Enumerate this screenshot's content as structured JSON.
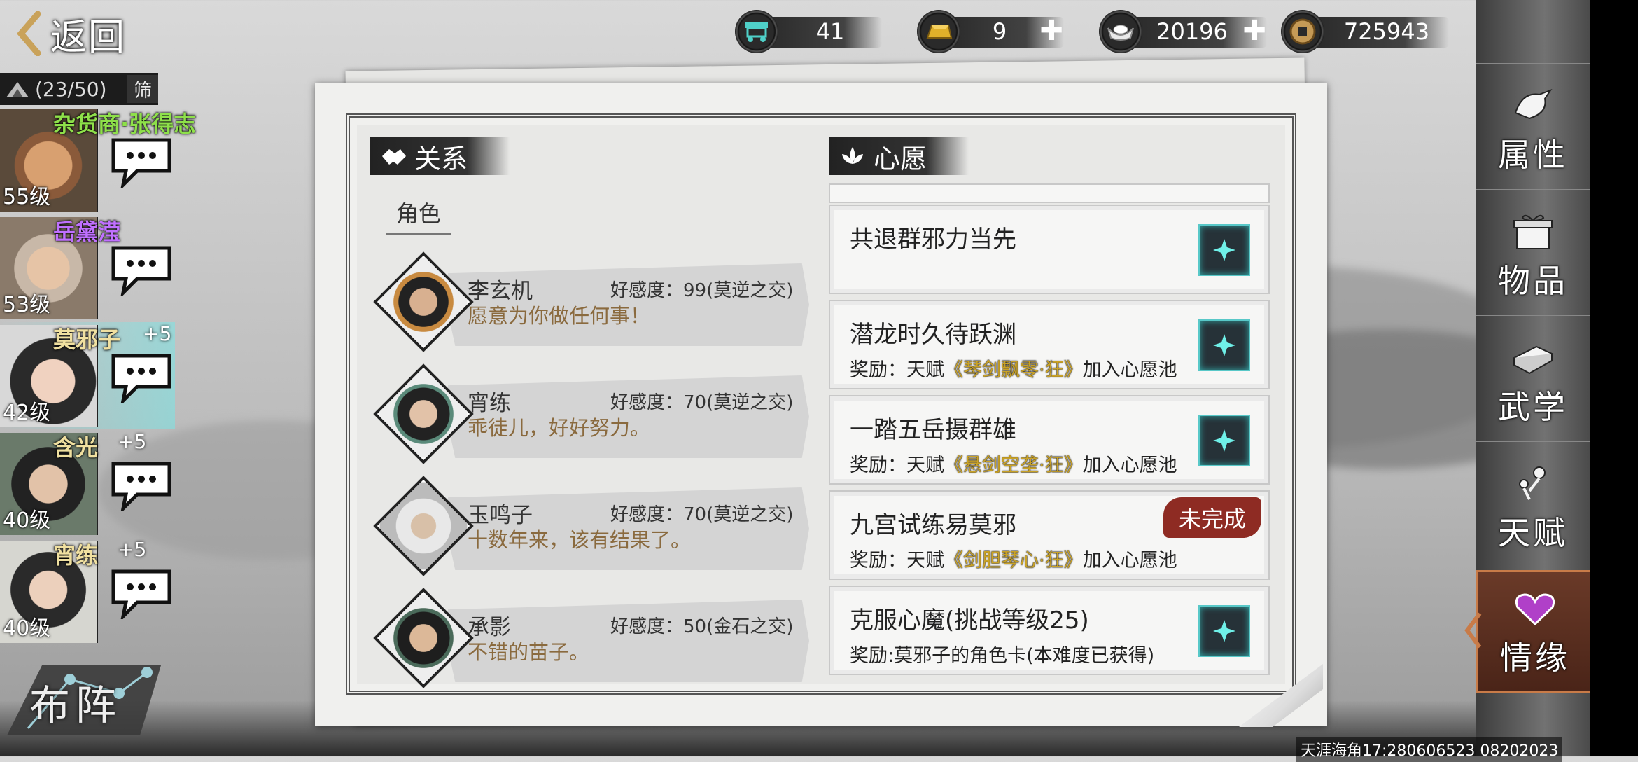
{
  "header": {
    "back_label": "返回",
    "currencies": [
      {
        "icon": "cart-icon",
        "value": "41",
        "has_plus": false
      },
      {
        "icon": "gold-ingot-icon",
        "value": "9",
        "has_plus": true
      },
      {
        "icon": "silver-ingot-icon",
        "value": "20196",
        "has_plus": true
      },
      {
        "icon": "copper-coin-icon",
        "value": "725943",
        "has_plus": false
      }
    ]
  },
  "roster": {
    "count": "(23/50)",
    "filter_label": "筛",
    "members": [
      {
        "name": "杂货商·张得志",
        "level": "55级",
        "bonus": "",
        "name_color": "#8ee04a",
        "active": false
      },
      {
        "name": "岳黛滢",
        "level": "53级",
        "bonus": "",
        "name_color": "#c070ff",
        "active": false
      },
      {
        "name": "莫邪子",
        "level": "42级",
        "bonus": "+5",
        "name_color": "#f0e0a0",
        "active": true
      },
      {
        "name": "含光",
        "level": "40级",
        "bonus": "+5",
        "name_color": "#f0e0a0",
        "active": false
      },
      {
        "name": "宵练",
        "level": "40级",
        "bonus": "+5",
        "name_color": "#f0e0a0",
        "active": false
      }
    ],
    "formation_label": "布阵"
  },
  "relations": {
    "title": "关系",
    "tab_label": "角色",
    "items": [
      {
        "name": "李玄机",
        "affinity": "好感度：99(莫逆之交)",
        "quote": "愿意为你做任何事！"
      },
      {
        "name": "宵练",
        "affinity": "好感度：70(莫逆之交)",
        "quote": "乖徒儿，好好努力。"
      },
      {
        "name": "玉鸣子",
        "affinity": "好感度：70(莫逆之交)",
        "quote": "十数年来，该有结果了。"
      },
      {
        "name": "承影",
        "affinity": "好感度：50(金石之交)",
        "quote": "不错的苗子。"
      }
    ]
  },
  "wishes": {
    "title": "心愿",
    "items": [
      {
        "title": "共退群邪力当先",
        "reward_prefix": "",
        "reward_book": "",
        "reward_suffix": "",
        "status": ""
      },
      {
        "title": "潜龙时久待跃渊",
        "reward_prefix": "奖励：天赋",
        "reward_book": "《琴剑飘零·狂》",
        "reward_suffix": "加入心愿池",
        "status": ""
      },
      {
        "title": "一踏五岳摄群雄",
        "reward_prefix": "奖励：天赋",
        "reward_book": "《悬剑空垄·狂》",
        "reward_suffix": "加入心愿池",
        "status": ""
      },
      {
        "title": "九宫试练易莫邪",
        "reward_prefix": "奖励：天赋",
        "reward_book": "《剑胆琴心·狂》",
        "reward_suffix": "加入心愿池",
        "status": "未完成"
      },
      {
        "title": "克服心魔(挑战等级25)",
        "reward_prefix": "奖励:莫邪子的角色卡(本难度已获得)",
        "reward_book": "",
        "reward_suffix": "",
        "status": ""
      }
    ]
  },
  "side_nav": {
    "items": [
      {
        "label": "属性",
        "icon": "bird-icon"
      },
      {
        "label": "物品",
        "icon": "gift-box-icon"
      },
      {
        "label": "武学",
        "icon": "book-icon"
      },
      {
        "label": "天赋",
        "icon": "talent-icon"
      },
      {
        "label": "情缘",
        "icon": "heart-icon"
      }
    ],
    "active": "情缘"
  },
  "watermark": "天涯海角17:280606523 08202023",
  "colors": {
    "accent_cyan": "#58c8c8",
    "status_red": "#8e2b23",
    "book_gold": "#c9a227"
  }
}
